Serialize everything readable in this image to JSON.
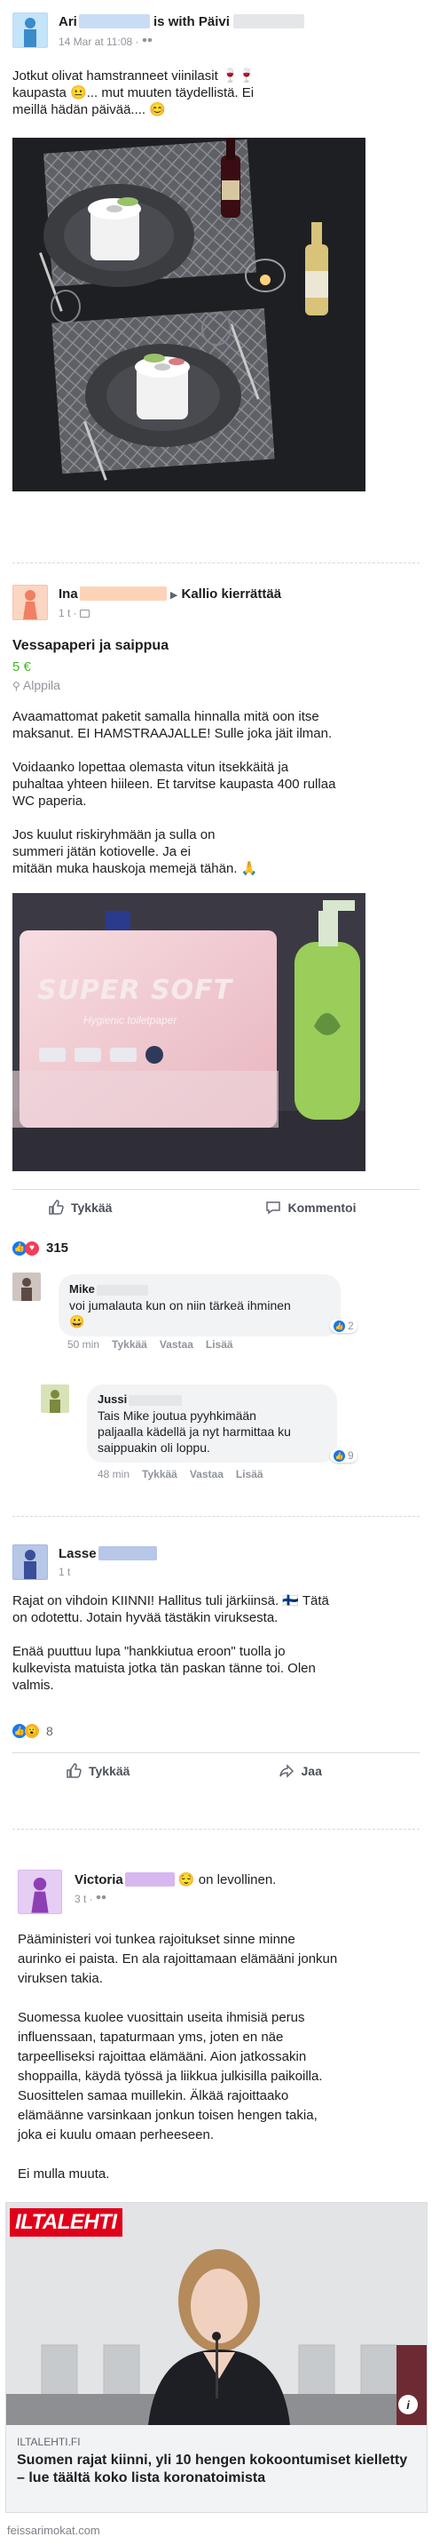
{
  "post1": {
    "author": "Ari",
    "with_text": "is with Päivi",
    "time": "14 Mar at 11:08 · ",
    "body": "Jotkut olivat hamstranneet viinilasit  🍷🍷\nkaupasta  😐... mut muuten täydellistä. Ei\nmeillä hädän päivää.... 😊"
  },
  "post2": {
    "author": "Ina",
    "group": "Kallio kierrättää",
    "time": "1 t · ",
    "listing_title": "Vessapaperi ja saippua",
    "price": "5 €",
    "location": "Alppila",
    "body": "Avaamattomat paketit samalla hinnalla mitä oon itse\nmaksanut. EI HAMSTRAAJALLE! Sulle joka jäit ilman.\n\nVoidaanko lopettaa olemasta vitun itsekkäitä ja\npuhaltaa yhteen hiileen. Et tarvitse kaupasta 400 rullaa\nWC paperia.\n\nJos kuulut riskiryhmään ja sulla on\nsummeri jätän kotiovelle. Ja ei\nmitään muka hauskoja memejä tähän. 🙏",
    "package_brand": "SUPER SOFT",
    "package_sub": "Hygienic toiletpaper",
    "like_label": "Tykkää",
    "comment_label": "Kommentoi",
    "reaction_count": "315",
    "comments": [
      {
        "author": "Mike",
        "text": "voi jumalauta kun on niin tärkeä ihminen\n😀",
        "time": "50 min",
        "like": "Tykkää",
        "reply": "Vastaa",
        "more": "Lisää",
        "count": "2"
      },
      {
        "author": "Jussi",
        "text": "Tais Mike joutua pyyhkimään\npaljaalla kädellä ja nyt harmittaa ku\nsaippuakin oli loppu.",
        "time": "48 min",
        "like": "Tykkää",
        "reply": "Vastaa",
        "more": "Lisää",
        "count": "9"
      }
    ]
  },
  "post3": {
    "author": "Lasse",
    "time": "1 t",
    "body": "Rajat on vihdoin KIINNI! Hallitus tuli järkiinsä. 🇫🇮 Tätä\non odotettu. Jotain hyvää tästäkin viruksesta.\n\nEnää puuttuu lupa \"hankkiutua eroon\" tuolla jo\nkulkevista matuista jotka tän paskan tänne toi. Olen\nvalmis.",
    "reaction_count": "8",
    "like_label": "Tykkää",
    "share_label": "Jaa"
  },
  "post4": {
    "author": "Victoria",
    "status": "on levollinen.",
    "time": "3 t · ",
    "body": "Pääministeri voi tunkea rajoitukset sinne minne\naurinko ei paista. En ala rajoittamaan elämääni jonkun\nviruksen takia.\n\nSuomessa kuolee vuosittain useita ihmisiä perus\ninfluenssaan, tapaturmaan yms, joten en näe\ntarpeelliseksi rajoittaa elämääni. Aion jatkossakin\nshoppailla, käydä työssä ja liikkua julkisilla paikoilla.\nSuosittelen samaa muillekin. Älkää rajoittaako\nelämäänne varsinkaan jonkun toisen hengen takia,\njoka ei kuulu omaan perheeseen.\n\nEi mulla muuta.",
    "link_logo": "ILTALEHTI",
    "link_domain": "ILTALEHTI.FI",
    "link_title": "Suomen rajat kiinni, yli 10 hengen kokoontumiset kielletty – lue täältä koko lista koronatoimista"
  },
  "watermark": "feissarimokat.com",
  "colors": {
    "redact_blue": "#c8dcf5",
    "redact_peach": "#fcd3b8",
    "redact_purple": "#d7b7f0",
    "fb_blue": "#1877f2"
  }
}
